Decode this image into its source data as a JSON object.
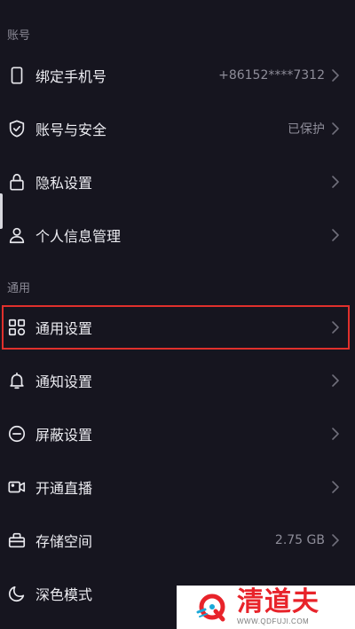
{
  "sections": [
    {
      "header": "账号",
      "items": [
        {
          "key": "bind-phone",
          "icon": "phone-icon",
          "label": "绑定手机号",
          "value": "+86152****7312"
        },
        {
          "key": "account-security",
          "icon": "shield-check-icon",
          "label": "账号与安全",
          "value": "已保护"
        },
        {
          "key": "privacy",
          "icon": "lock-icon",
          "label": "隐私设置",
          "value": ""
        },
        {
          "key": "personal-info",
          "icon": "person-icon",
          "label": "个人信息管理",
          "value": ""
        }
      ]
    },
    {
      "header": "通用",
      "items": [
        {
          "key": "general-settings",
          "icon": "grid-apps-icon",
          "label": "通用设置",
          "value": ""
        },
        {
          "key": "notifications",
          "icon": "bell-icon",
          "label": "通知设置",
          "value": ""
        },
        {
          "key": "block-settings",
          "icon": "minus-circle-icon",
          "label": "屏蔽设置",
          "value": ""
        },
        {
          "key": "live-streaming",
          "icon": "video-camera-icon",
          "label": "开通直播",
          "value": ""
        },
        {
          "key": "storage",
          "icon": "storage-box-icon",
          "label": "存储空间",
          "value": "2.75 GB"
        },
        {
          "key": "dark-mode",
          "icon": "moon-icon",
          "label": "深色模式",
          "value": ""
        }
      ]
    }
  ],
  "watermark": {
    "name": "清道夫",
    "url": "WWW.QDFUJI.COM"
  },
  "colors": {
    "background": "#16151f",
    "text": "#ececf1",
    "muted": "#8e8d99",
    "highlight_border": "#e0302c",
    "watermark_red": "#e8232a"
  }
}
